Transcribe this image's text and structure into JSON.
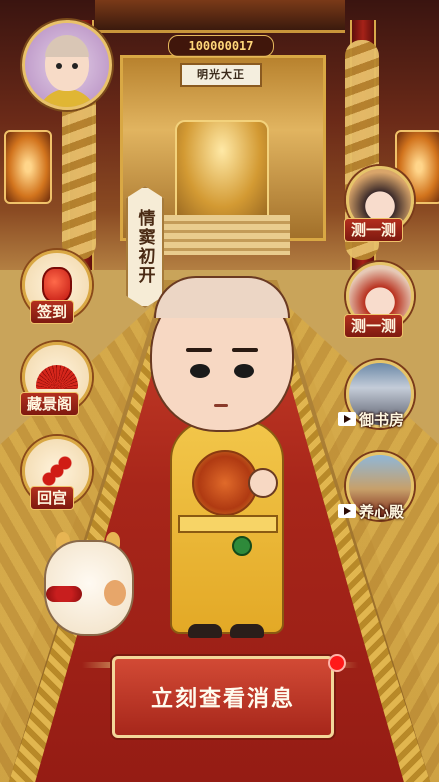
{
  "header": {
    "currency_value": "100000017",
    "plaque_text": "明光大正"
  },
  "banner": {
    "text": "情窦初开"
  },
  "left_menu": [
    {
      "label": "签到",
      "icon": "lantern-icon"
    },
    {
      "label": "藏景阁",
      "icon": "fan-icon"
    },
    {
      "label": "回宫",
      "icon": "candied-haws-icon"
    }
  ],
  "right_menu": [
    {
      "label": "测一测",
      "icon": "empress-portrait"
    },
    {
      "label": "测一测",
      "icon": "official-portrait"
    },
    {
      "label": "御书房",
      "icon": "video-play-icon"
    },
    {
      "label": "养心殿",
      "icon": "video-play-icon"
    }
  ],
  "message_button": {
    "label": "立刻查看消息",
    "has_notification": true
  },
  "colors": {
    "accent_red": "#a7271b",
    "gold": "#e9c26a",
    "cream": "#f6ecd6"
  }
}
